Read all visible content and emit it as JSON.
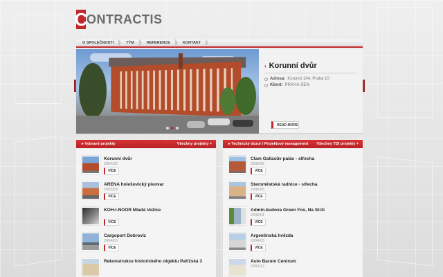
{
  "logo": {
    "initial": "C",
    "rest": "ONTRACTIS"
  },
  "nav": {
    "items": [
      "O SPOLEČNOSTI",
      "TÝM",
      "REFERENCE",
      "KONTAKT"
    ]
  },
  "slider": {
    "title": "Korunní dvůr",
    "address_label": "Adresa:",
    "address_value": "Korunní 104, Praha 10",
    "client_label": "Klient:",
    "client_value": "PRAHA-SEN",
    "read_more": "READ MORE",
    "prev": "‹",
    "next": "›"
  },
  "left_column": {
    "title": "Vybrané projekty",
    "link": "Všechny projekty",
    "button_label": "VÍCE",
    "items": [
      {
        "title": "Korunní dvůr",
        "date": "2004/05"
      },
      {
        "title": "ARENA holešovický pivovar",
        "date": "2003/05"
      },
      {
        "title": "KOH-I-NOOR Mladá Vožice",
        "date": ""
      },
      {
        "title": "Cargoport Dobroviz",
        "date": "2004/05"
      },
      {
        "title": "Rekonstrukce historického objektu Pařížská 3",
        "date": ""
      }
    ]
  },
  "right_column": {
    "title": "Technický dozor / Projektový management",
    "link": "Všechny TDI projekty",
    "button_label": "VÍCE",
    "items": [
      {
        "title": "Clam Gallasův palác - střecha",
        "date": "2005/05"
      },
      {
        "title": "Staroměstská radnice - střecha",
        "date": "2006/05"
      },
      {
        "title": "Admin.budova Green Fox, Na Strži",
        "date": "2005/01"
      },
      {
        "title": "Argentinská hvězda",
        "date": "2004/03"
      },
      {
        "title": "Auto Barum Centrum",
        "date": "2003/12"
      }
    ]
  },
  "colors": {
    "accent": "#c0282b",
    "background": "#e7e7e7"
  }
}
